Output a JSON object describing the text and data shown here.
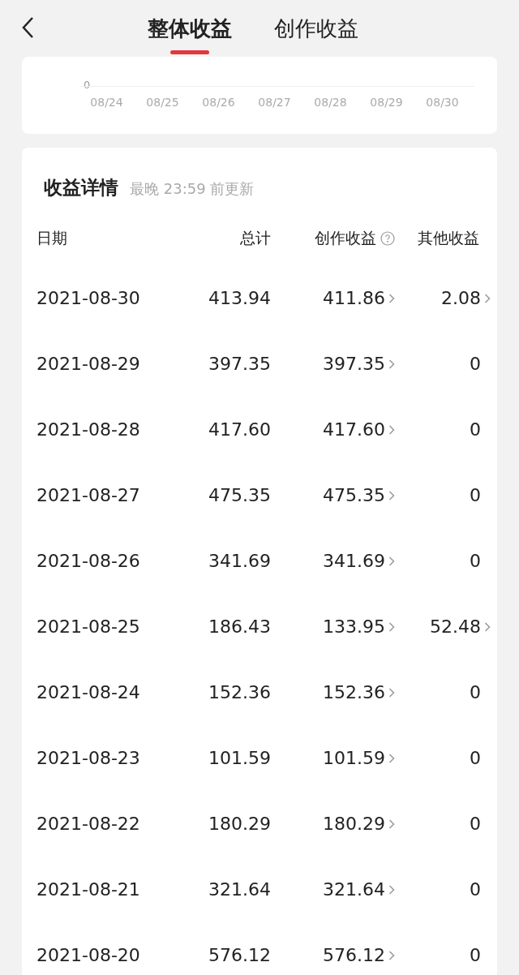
{
  "tabs": [
    {
      "label": "整体收益",
      "selected": true
    },
    {
      "label": "创作收益",
      "selected": false
    }
  ],
  "chart": {
    "y_tick": "0",
    "x_labels": [
      "08/24",
      "08/25",
      "08/26",
      "08/27",
      "08/28",
      "08/29",
      "08/30"
    ]
  },
  "details": {
    "title": "收益详情",
    "subtitle": "最晚 23:59 前更新",
    "columns": [
      "日期",
      "总计",
      "创作收益",
      "其他收益"
    ],
    "rows": [
      {
        "date": "2021-08-30",
        "total": "413.94",
        "creation": "411.86",
        "other": "2.08",
        "other_link": true
      },
      {
        "date": "2021-08-29",
        "total": "397.35",
        "creation": "397.35",
        "other": "0",
        "other_link": false
      },
      {
        "date": "2021-08-28",
        "total": "417.60",
        "creation": "417.60",
        "other": "0",
        "other_link": false
      },
      {
        "date": "2021-08-27",
        "total": "475.35",
        "creation": "475.35",
        "other": "0",
        "other_link": false
      },
      {
        "date": "2021-08-26",
        "total": "341.69",
        "creation": "341.69",
        "other": "0",
        "other_link": false
      },
      {
        "date": "2021-08-25",
        "total": "186.43",
        "creation": "133.95",
        "other": "52.48",
        "other_link": true
      },
      {
        "date": "2021-08-24",
        "total": "152.36",
        "creation": "152.36",
        "other": "0",
        "other_link": false
      },
      {
        "date": "2021-08-23",
        "total": "101.59",
        "creation": "101.59",
        "other": "0",
        "other_link": false
      },
      {
        "date": "2021-08-22",
        "total": "180.29",
        "creation": "180.29",
        "other": "0",
        "other_link": false
      },
      {
        "date": "2021-08-21",
        "total": "321.64",
        "creation": "321.64",
        "other": "0",
        "other_link": false
      },
      {
        "date": "2021-08-20",
        "total": "576.12",
        "creation": "576.12",
        "other": "0",
        "other_link": false
      }
    ]
  }
}
